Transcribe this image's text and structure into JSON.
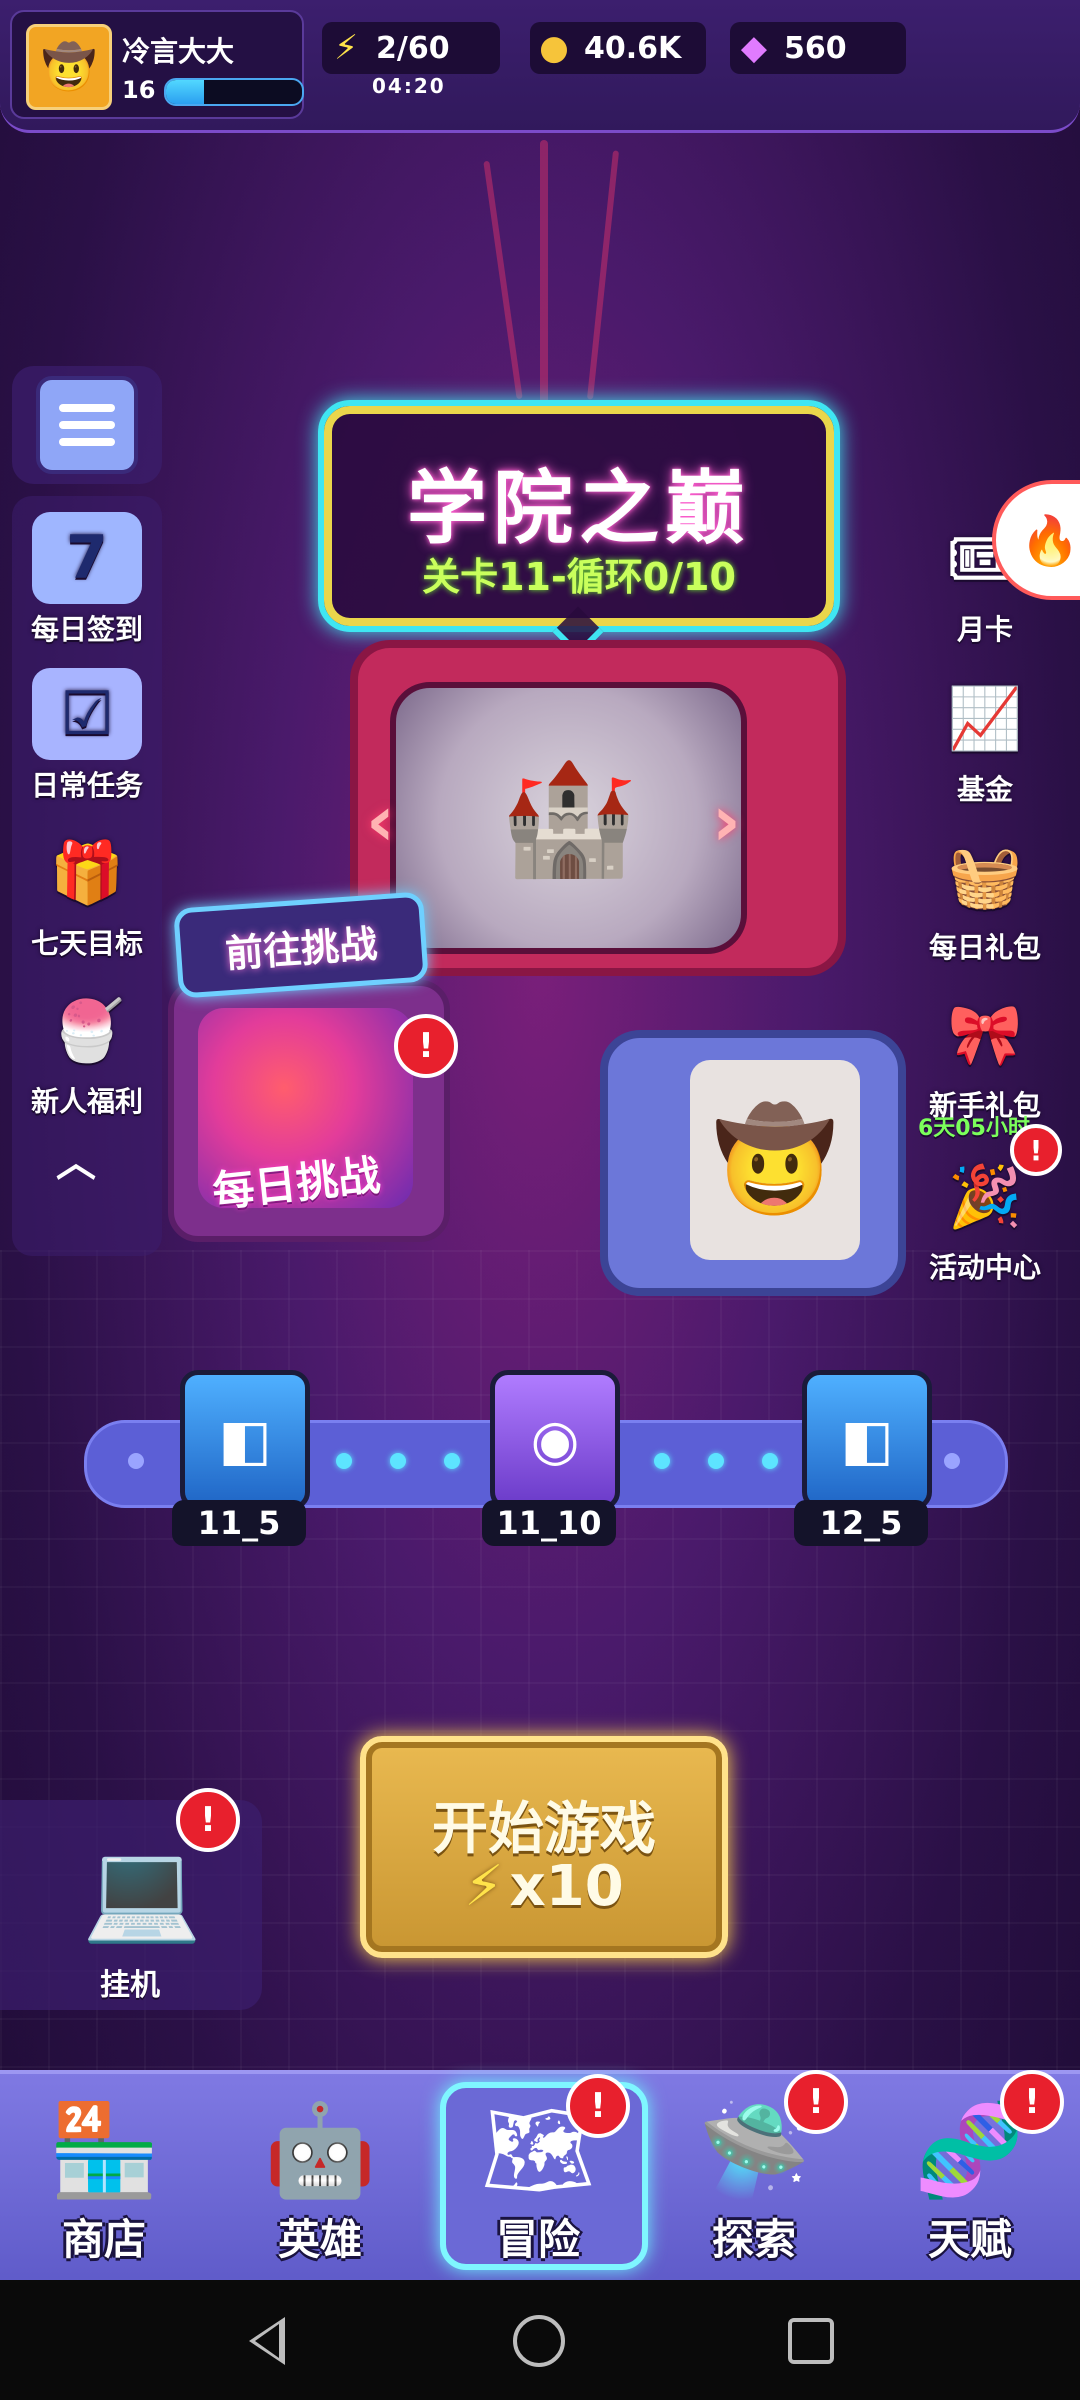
{
  "player": {
    "name": "冷言大大",
    "level": "16",
    "xp_fraction": 0.28
  },
  "resources": {
    "energy": "2/60",
    "energy_timer": "04:20",
    "coins": "40.6K",
    "gems": "560"
  },
  "left_menu": [
    {
      "label": "每日签到",
      "icon": "calendar-icon"
    },
    {
      "label": "日常任务",
      "icon": "task-list-icon"
    },
    {
      "label": "七天目标",
      "icon": "gift-box-icon"
    },
    {
      "label": "新人福利",
      "icon": "welfare-bowl-icon"
    }
  ],
  "right_menu": [
    {
      "label": "月卡",
      "icon": "card-icon"
    },
    {
      "label": "基金",
      "icon": "fund-icon"
    },
    {
      "label": "每日礼包",
      "icon": "daily-pack-icon"
    },
    {
      "label": "新手礼包",
      "icon": "newbie-pack-icon"
    },
    {
      "label": "活动中心",
      "icon": "event-party-icon"
    }
  ],
  "newbie_pack_timer": "6天05小时",
  "stage": {
    "title": "学院之巅",
    "subtitle": "关卡11-循环0/10"
  },
  "daily_challenge": {
    "go_label": "前往挑战",
    "label": "每日挑战"
  },
  "track": [
    {
      "label": "11_5",
      "type": "blue"
    },
    {
      "label": "11_10",
      "type": "purple"
    },
    {
      "label": "12_5",
      "type": "blue"
    }
  ],
  "start": {
    "label": "开始游戏",
    "cost": "x10"
  },
  "afk": {
    "label": "挂机"
  },
  "bottom_nav": [
    {
      "label": "商店",
      "icon": "shop-icon"
    },
    {
      "label": "英雄",
      "icon": "hero-icon"
    },
    {
      "label": "冒险",
      "icon": "adventure-map-icon"
    },
    {
      "label": "探索",
      "icon": "explore-icon"
    },
    {
      "label": "天赋",
      "icon": "talent-dna-icon"
    }
  ],
  "badge_mark": "!",
  "colors": {
    "accent_cyan": "#3fe6f2",
    "badge_red": "#e8202d",
    "start_gold": "#e9b950",
    "nav_purple": "#7f79e3"
  }
}
